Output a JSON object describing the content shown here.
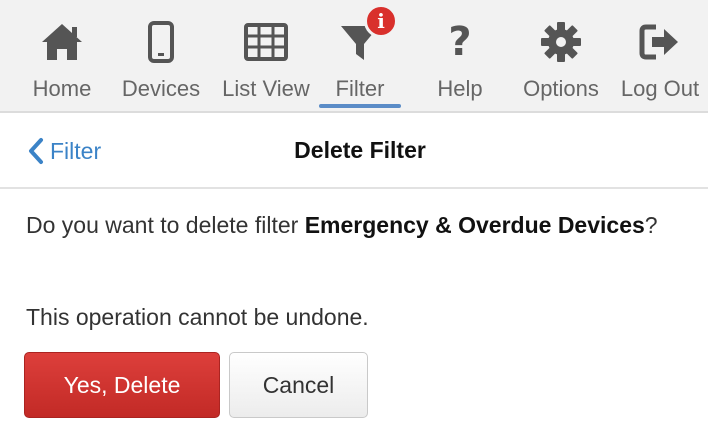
{
  "colors": {
    "toolbar_bg": "#f2f2f2",
    "icon": "#555555",
    "active_underline": "#5b8cc7",
    "badge": "#d9302c",
    "link": "#3b83c7",
    "danger": "#d0332f"
  },
  "toolbar": {
    "items": [
      {
        "label": "Home",
        "icon": "home-icon"
      },
      {
        "label": "Devices",
        "icon": "mobile-device-icon"
      },
      {
        "label": "List View",
        "icon": "grid-icon"
      },
      {
        "label": "Filter",
        "icon": "filter-funnel-icon",
        "active": true,
        "badge": "i"
      },
      {
        "label": "Help",
        "icon": "question-mark-icon",
        "glyph": "?"
      },
      {
        "label": "Options",
        "icon": "gear-icon"
      },
      {
        "label": "Log Out",
        "icon": "log-out-icon"
      }
    ]
  },
  "header": {
    "back_label": "Filter",
    "title": "Delete Filter"
  },
  "dialog": {
    "question_prefix": "Do you want to delete filter ",
    "filter_name": "Emergency & Overdue Devices",
    "question_suffix": "?",
    "warning": "This operation cannot be undone.",
    "confirm_label": "Yes, Delete",
    "cancel_label": "Cancel"
  }
}
